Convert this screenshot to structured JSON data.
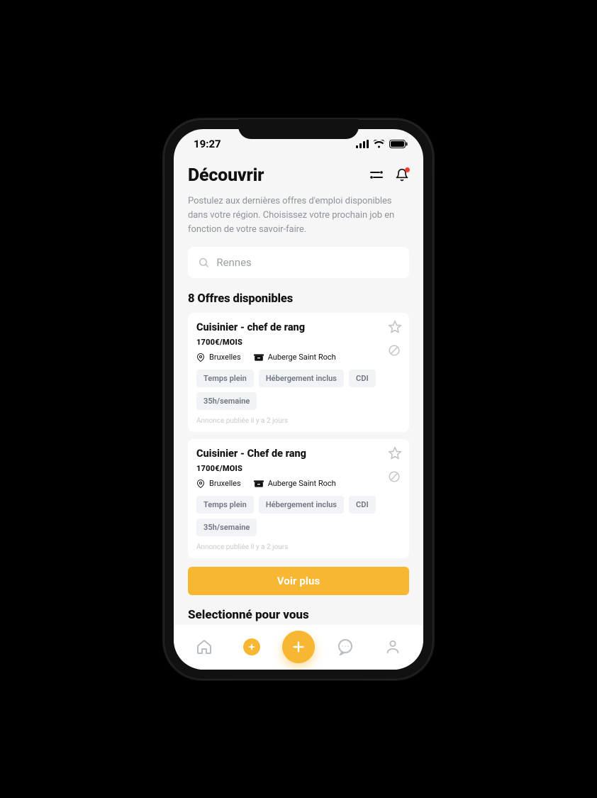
{
  "status": {
    "time": "19:27"
  },
  "header": {
    "title": "Découvrir",
    "subtitle": "Postulez aux dernières offres d'emploi disponibles dans votre région. Choisissez votre prochain job en fonction de votre savoir-faire.",
    "has_notification_dot": true
  },
  "search": {
    "placeholder": "Rennes",
    "value": ""
  },
  "offers": {
    "count_label": "8 Offres disponibles",
    "items": [
      {
        "title": "Cuisinier - chef de rang",
        "salary": "1700€/MOIS",
        "location": "Bruxelles",
        "venue": "Auberge Saint Roch",
        "tags": [
          "Temps plein",
          "Hébergement inclus",
          "CDI",
          "35h/semaine"
        ],
        "published": "Annonce publiée il y a 2 jours"
      },
      {
        "title": "Cuisinier - Chef de rang",
        "salary": "1700€/MOIS",
        "location": "Bruxelles",
        "venue": "Auberge Saint Roch",
        "tags": [
          "Temps plein",
          "Hébergement inclus",
          "CDI",
          "35h/semaine"
        ],
        "published": "Annonce publiée il y a 2 jours"
      }
    ],
    "see_more_label": "Voir plus"
  },
  "selected_for_you": {
    "title": "Selectionné pour vous"
  },
  "tabs": {
    "items": [
      "home",
      "discover",
      "add",
      "chat",
      "profile"
    ],
    "active_index": 1
  },
  "colors": {
    "accent": "#f7b733",
    "danger": "#ff3b30",
    "muted": "#8e939c",
    "chip_bg": "#f1f3f6"
  }
}
